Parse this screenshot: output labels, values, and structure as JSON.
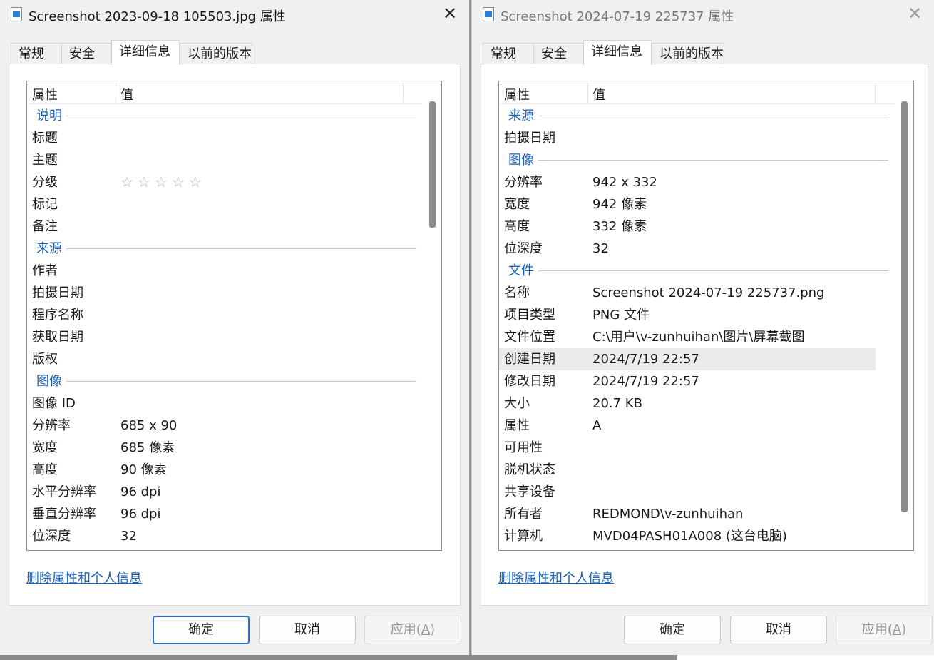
{
  "left_dialog": {
    "title": "Screenshot 2023-09-18 105503.jpg 属性",
    "close_glyph": "✕",
    "tabs": [
      "常规",
      "安全",
      "详细信息",
      "以前的版本"
    ],
    "header": {
      "col1": "属性",
      "col2": "值"
    },
    "groups": {
      "description": "说明",
      "origin": "来源",
      "image": "图像"
    },
    "rows_description": [
      {
        "k": "标题",
        "v": ""
      },
      {
        "k": "主题",
        "v": ""
      },
      {
        "k": "分级",
        "v": ""
      },
      {
        "k": "标记",
        "v": ""
      },
      {
        "k": "备注",
        "v": ""
      }
    ],
    "rating_stars": "☆☆☆☆☆",
    "rows_origin": [
      {
        "k": "作者",
        "v": ""
      },
      {
        "k": "拍摄日期",
        "v": ""
      },
      {
        "k": "程序名称",
        "v": ""
      },
      {
        "k": "获取日期",
        "v": ""
      },
      {
        "k": "版权",
        "v": ""
      }
    ],
    "rows_image": [
      {
        "k": "图像 ID",
        "v": ""
      },
      {
        "k": "分辨率",
        "v": "685 x 90"
      },
      {
        "k": "宽度",
        "v": "685 像素"
      },
      {
        "k": "高度",
        "v": "90 像素"
      },
      {
        "k": "水平分辨率",
        "v": "96 dpi"
      },
      {
        "k": "垂直分辨率",
        "v": "96 dpi"
      },
      {
        "k": "位深度",
        "v": "32"
      }
    ],
    "link": "删除属性和个人信息",
    "buttons": {
      "ok": "确定",
      "cancel": "取消",
      "apply": "应用(",
      "apply_key": "A",
      "apply_end": ")"
    }
  },
  "right_dialog": {
    "title": "Screenshot 2024-07-19 225737 属性",
    "close_glyph": "✕",
    "tabs": [
      "常规",
      "安全",
      "详细信息",
      "以前的版本"
    ],
    "header": {
      "col1": "属性",
      "col2": "值"
    },
    "groups": {
      "origin": "来源",
      "image": "图像",
      "file": "文件"
    },
    "rows_origin": [
      {
        "k": "拍摄日期",
        "v": ""
      }
    ],
    "rows_image": [
      {
        "k": "分辨率",
        "v": "942 x 332"
      },
      {
        "k": "宽度",
        "v": "942 像素"
      },
      {
        "k": "高度",
        "v": "332 像素"
      },
      {
        "k": "位深度",
        "v": "32"
      }
    ],
    "rows_file": [
      {
        "k": "名称",
        "v": "Screenshot 2024-07-19 225737.png"
      },
      {
        "k": "项目类型",
        "v": "PNG 文件"
      },
      {
        "k": "文件位置",
        "v": "C:\\用户\\v-zunhuihan\\图片\\屏幕截图"
      },
      {
        "k": "创建日期",
        "v": "2024/7/19 22:57"
      },
      {
        "k": "修改日期",
        "v": "2024/7/19 22:57"
      },
      {
        "k": "大小",
        "v": "20.7 KB"
      },
      {
        "k": "属性",
        "v": "A"
      },
      {
        "k": "可用性",
        "v": ""
      },
      {
        "k": "脱机状态",
        "v": ""
      },
      {
        "k": "共享设备",
        "v": ""
      },
      {
        "k": "所有者",
        "v": "REDMOND\\v-zunhuihan"
      },
      {
        "k": "计算机",
        "v": "MVD04PASH01A008 (这台电脑)"
      }
    ],
    "link": "删除属性和个人信息",
    "buttons": {
      "ok": "确定",
      "cancel": "取消",
      "apply": "应用(",
      "apply_key": "A",
      "apply_end": ")"
    }
  }
}
